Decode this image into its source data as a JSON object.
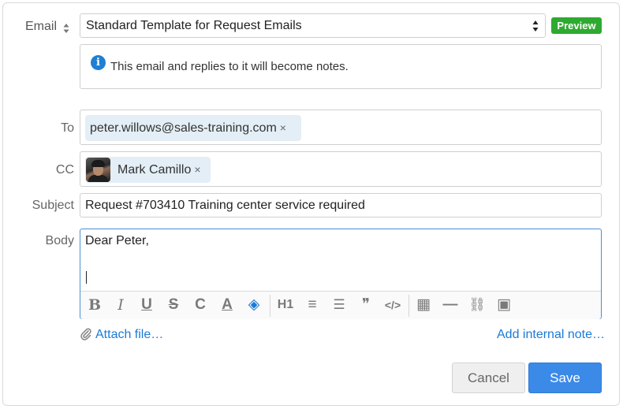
{
  "form": {
    "email_label": "Email",
    "template_value": "Standard Template for Request Emails",
    "preview_label": "Preview",
    "info_text": "This email and replies to it will become notes.",
    "to_label": "To",
    "to_recipients": [
      {
        "email": "peter.willows@sales-training.com"
      }
    ],
    "cc_label": "CC",
    "cc_recipients": [
      {
        "name": "Mark Camillo"
      }
    ],
    "subject_label": "Subject",
    "subject_value": "Request #703410 Training center service required",
    "body_label": "Body",
    "body_text": "Dear Peter,",
    "remove_glyph": "×"
  },
  "toolbar": {
    "buttons": [
      {
        "icon": "bold-icon",
        "glyph": "B"
      },
      {
        "icon": "italic-icon",
        "glyph": "I"
      },
      {
        "icon": "underline-icon",
        "glyph": "U"
      },
      {
        "icon": "strikethrough-icon",
        "glyph": "S"
      },
      {
        "icon": "clear-format-icon",
        "glyph": "C"
      },
      {
        "icon": "text-color-icon",
        "glyph": "A"
      },
      {
        "icon": "highlight-icon",
        "glyph": "◈"
      },
      {
        "icon": "heading-icon",
        "glyph": "H1"
      },
      {
        "icon": "numbered-list-icon",
        "glyph": "≡"
      },
      {
        "icon": "bullet-list-icon",
        "glyph": "☰"
      },
      {
        "icon": "quote-icon",
        "glyph": "❞"
      },
      {
        "icon": "code-icon",
        "glyph": "</>"
      },
      {
        "icon": "table-icon",
        "glyph": "▦"
      },
      {
        "icon": "horizontal-rule-icon",
        "glyph": "—"
      },
      {
        "icon": "link-icon",
        "glyph": "⛓"
      },
      {
        "icon": "image-icon",
        "glyph": "▣"
      }
    ]
  },
  "footer": {
    "attach_label": "Attach file…",
    "internal_note_label": "Add internal note…",
    "cancel_label": "Cancel",
    "save_label": "Save"
  },
  "colors": {
    "preview_green": "#2eaa30",
    "link_blue": "#1b7ad6",
    "save_blue": "#3b8ae8",
    "token_bg": "#e3eef6",
    "info_blue": "#1e7fd4"
  }
}
